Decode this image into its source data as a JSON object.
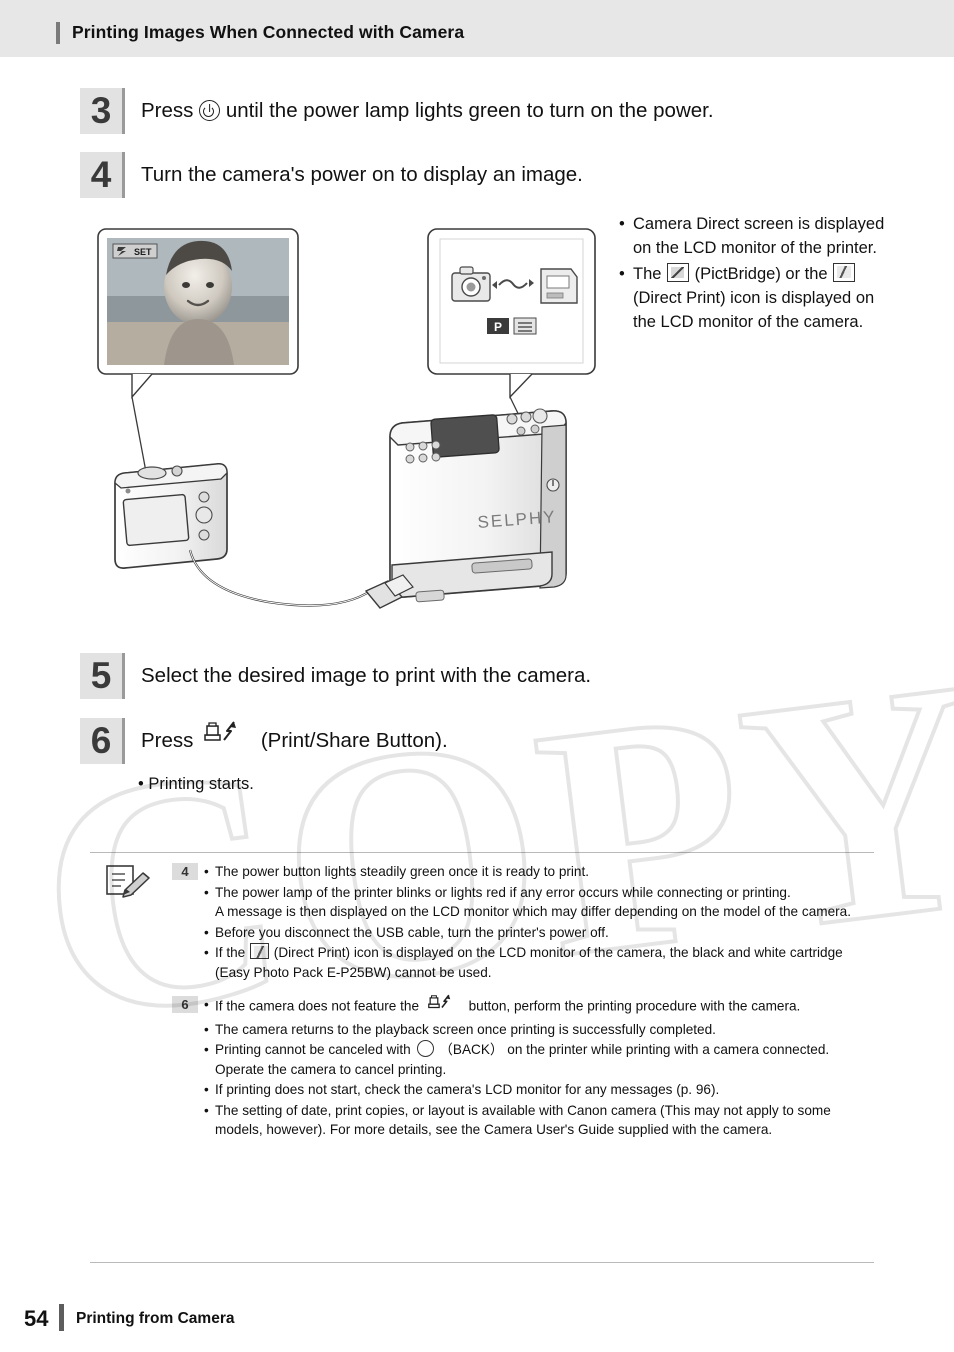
{
  "header": {
    "title": "Printing Images When Connected with Camera"
  },
  "steps": [
    {
      "number": "3",
      "text_before": "Press",
      "icon": "power-icon",
      "text_after": "until the power lamp lights green to turn on the power."
    },
    {
      "number": "4",
      "text_before": "Turn the camera's power on to display an image.",
      "icon": "",
      "text_after": ""
    },
    {
      "number": "5",
      "text_before": "Select the desired image to print with the camera.",
      "icon": "",
      "text_after": ""
    },
    {
      "number": "6",
      "text_before": "Press",
      "icon": "print-share-icon",
      "text_after": "(Print/Share Button)."
    }
  ],
  "figure": {
    "camera_screen_badge": "SET",
    "printer_brand": "SELPHY",
    "printer_screen_icons": [
      "camera-icon",
      "s-link-icon",
      "printer-icon",
      "p-button-icon",
      "list-icon"
    ]
  },
  "notes_right": [
    "Camera Direct screen is displayed on the LCD monitor of the printer.",
    {
      "pre": "The",
      "icon1": "pictbridge-icon",
      "mid1": "(PictBridge) or the",
      "icon2": "direct-print-icon",
      "mid2": "(Direct Print) icon is displayed on the LCD monitor of the camera."
    }
  ],
  "step6_sub": "Printing starts.",
  "notes": {
    "memo_icon": "memo-pencil-icon",
    "groups": [
      {
        "badge": "4",
        "items": [
          {
            "text": "The power button lights steadily green once it is ready to print."
          },
          {
            "text": "The power lamp of the printer blinks or lights red if any error occurs while connecting or printing.",
            "sub": "A message is then displayed on the LCD monitor which may differ depending on the model of the camera."
          },
          {
            "text": "Before you disconnect the USB cable, turn the printer's power off."
          },
          {
            "pre": "If the",
            "icon": "direct-print-icon",
            "post": "(Direct Print) icon is displayed on the LCD monitor of the camera, the black and white cartridge (Easy Photo Pack E-P25BW) cannot be used."
          }
        ]
      },
      {
        "badge": "6",
        "items": [
          {
            "pre": "If the camera does not feature the",
            "icon": "print-share-icon",
            "post": "button, perform the printing procedure with the camera."
          },
          {
            "text": "The camera returns to the playback screen once printing is successfully completed."
          },
          {
            "pre": "Printing cannot be canceled with",
            "icon": "back-circle-icon",
            "post": "（BACK） on the printer while printing with a camera connected. Operate the camera to cancel printing."
          },
          {
            "text": "If printing does not start, check the camera's LCD monitor for any messages (p. 96)."
          },
          {
            "text": "The setting of date, print copies, or layout is available with Canon camera (This may not apply to some models, however). For more details, see the Camera User's Guide supplied with the camera."
          }
        ]
      }
    ]
  },
  "footer": {
    "page_number": "54",
    "section": "Printing from Camera"
  },
  "watermark": {
    "text": "COPY"
  },
  "colors": {
    "header_band": "#e7e7e7",
    "step_badge": "#e2e2e2",
    "accent_bar": "#5d5d5d"
  }
}
